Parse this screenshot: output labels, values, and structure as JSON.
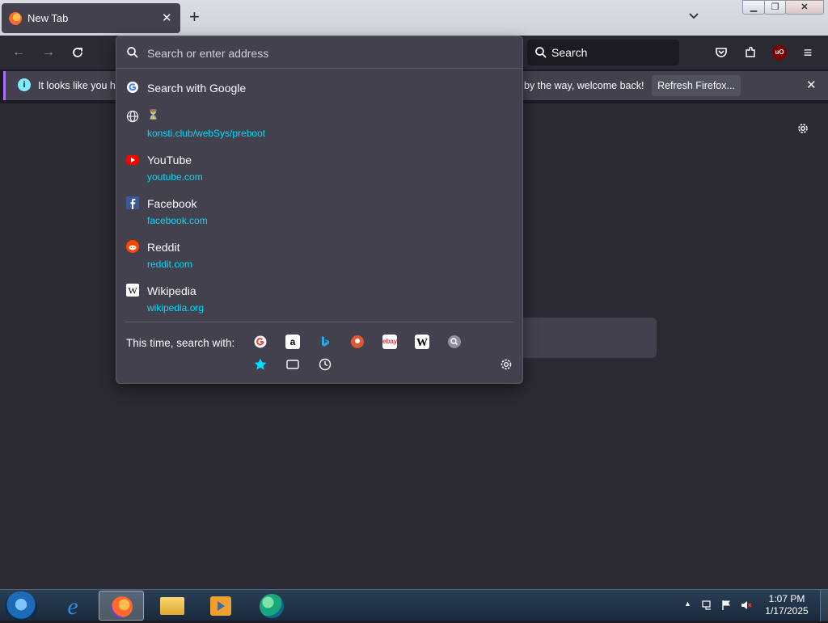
{
  "tab": {
    "title": "New Tab"
  },
  "urlbar": {
    "placeholder": "Search or enter address"
  },
  "searchbar": {
    "placeholder": "Search"
  },
  "notification": {
    "message_start": "It looks like you ha",
    "message_end": "by the way, welcome back!",
    "button": "Refresh Firefox..."
  },
  "dropdown": {
    "search_with": "Search with Google",
    "results": [
      {
        "title": "⏳",
        "url": "konsti.club/webSys/preboot",
        "icon": "globe-icon"
      },
      {
        "title": "YouTube",
        "url": "youtube.com",
        "icon": "youtube-icon"
      },
      {
        "title": "Facebook",
        "url": "facebook.com",
        "icon": "facebook-icon"
      },
      {
        "title": "Reddit",
        "url": "reddit.com",
        "icon": "reddit-icon"
      },
      {
        "title": "Wikipedia",
        "url": "wikipedia.org",
        "icon": "wikipedia-icon"
      }
    ],
    "this_time_label": "This time, search with:"
  },
  "taskbar": {
    "time": "1:07 PM",
    "date": "1/17/2025"
  },
  "colors": {
    "accent_url": "#00ddff",
    "notification_bar": "#a970ff",
    "panel": "#42414d",
    "page": "#2b2a33"
  }
}
